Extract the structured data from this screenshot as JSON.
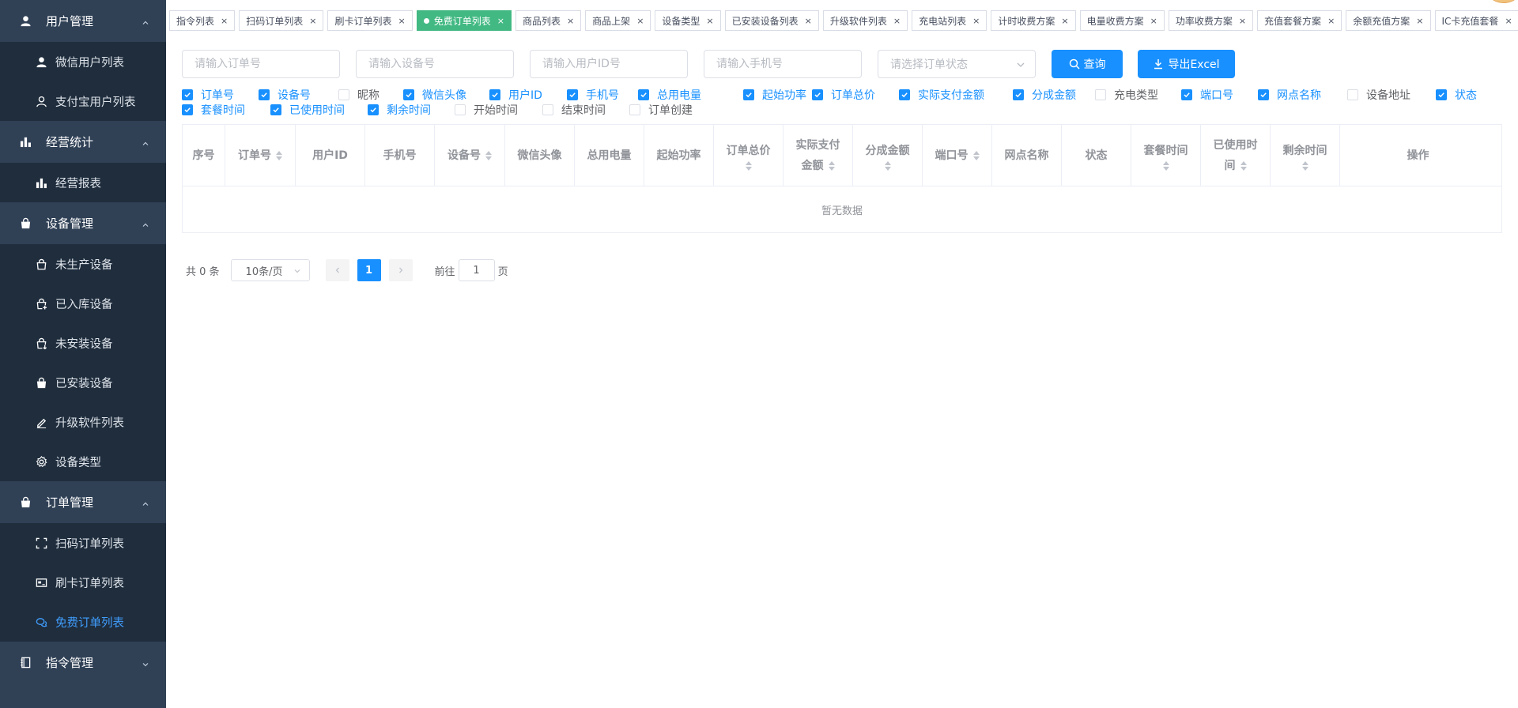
{
  "sidebar": {
    "groups": [
      {
        "title": "用户管理",
        "icon": "user-icon",
        "items": [
          {
            "label": "微信用户列表",
            "icon": "user-icon"
          },
          {
            "label": "支付宝用户列表",
            "icon": "user-outline-icon"
          }
        ]
      },
      {
        "title": "经营统计",
        "icon": "bar-chart-icon",
        "items": [
          {
            "label": "经营报表",
            "icon": "bar-chart-icon"
          }
        ]
      },
      {
        "title": "设备管理",
        "icon": "bag-icon",
        "items": [
          {
            "label": "未生产设备",
            "icon": "bag-outline-icon"
          },
          {
            "label": "已入库设备",
            "icon": "bag-plus-icon"
          },
          {
            "label": "未安装设备",
            "icon": "bag-minus-icon"
          },
          {
            "label": "已安装设备",
            "icon": "bag-icon"
          },
          {
            "label": "升级软件列表",
            "icon": "pencil-icon"
          },
          {
            "label": "设备类型",
            "icon": "gear-icon"
          }
        ]
      },
      {
        "title": "订单管理",
        "icon": "bag-icon",
        "items": [
          {
            "label": "扫码订单列表",
            "icon": "scan-icon"
          },
          {
            "label": "刷卡订单列表",
            "icon": "card-icon"
          },
          {
            "label": "免费订单列表",
            "icon": "free-order-icon",
            "active": true
          }
        ]
      },
      {
        "title": "指令管理",
        "icon": "notebook-icon",
        "items": []
      }
    ]
  },
  "tags": [
    {
      "label": "指令列表"
    },
    {
      "label": "扫码订单列表"
    },
    {
      "label": "刷卡订单列表"
    },
    {
      "label": "免费订单列表",
      "active": true
    },
    {
      "label": "商品列表"
    },
    {
      "label": "商品上架"
    },
    {
      "label": "设备类型"
    },
    {
      "label": "已安装设备列表"
    },
    {
      "label": "升级软件列表"
    },
    {
      "label": "充电站列表"
    },
    {
      "label": "计时收费方案"
    },
    {
      "label": "电量收费方案"
    },
    {
      "label": "功率收费方案"
    },
    {
      "label": "充值套餐方案"
    },
    {
      "label": "余额充值方案"
    },
    {
      "label": "IC卡充值套餐"
    }
  ],
  "filters": {
    "order_no_placeholder": "请输入订单号",
    "device_no_placeholder": "请输入设备号",
    "user_id_placeholder": "请输入用户ID号",
    "phone_placeholder": "请输入手机号",
    "status_placeholder": "请选择订单状态",
    "query_label": "查询",
    "export_label": "导出Excel"
  },
  "columns_toggle": [
    {
      "label": "订单号",
      "checked": true
    },
    {
      "label": "设备号",
      "checked": true
    },
    {
      "label": "昵称",
      "checked": false
    },
    {
      "label": "微信头像",
      "checked": true
    },
    {
      "label": "用户ID",
      "checked": true
    },
    {
      "label": "手机号",
      "checked": true
    },
    {
      "label": "总用电量",
      "checked": true
    },
    {
      "label": "起始功率",
      "checked": true
    },
    {
      "label": "订单总价",
      "checked": true
    },
    {
      "label": "实际支付金额",
      "checked": true
    },
    {
      "label": "分成金额",
      "checked": true
    },
    {
      "label": "充电类型",
      "checked": false
    },
    {
      "label": "端口号",
      "checked": true
    },
    {
      "label": "网点名称",
      "checked": true
    },
    {
      "label": "设备地址",
      "checked": false
    },
    {
      "label": "状态",
      "checked": true
    },
    {
      "label": "套餐时间",
      "checked": true
    },
    {
      "label": "已使用时间",
      "checked": true
    },
    {
      "label": "剩余时间",
      "checked": true
    },
    {
      "label": "开始时间",
      "checked": false
    },
    {
      "label": "结束时间",
      "checked": false
    },
    {
      "label": "订单创建",
      "checked": false
    }
  ],
  "table": {
    "headers": [
      {
        "lines": [
          "序号"
        ],
        "sortable": false
      },
      {
        "lines": [
          "订单号"
        ],
        "sortable": true
      },
      {
        "lines": [
          "用户ID"
        ],
        "sortable": false
      },
      {
        "lines": [
          "手机号"
        ],
        "sortable": false
      },
      {
        "lines": [
          "设备号"
        ],
        "sortable": true
      },
      {
        "lines": [
          "微信头像"
        ],
        "sortable": false
      },
      {
        "lines": [
          "总用电量"
        ],
        "sortable": false
      },
      {
        "lines": [
          "起始功率"
        ],
        "sortable": false
      },
      {
        "lines": [
          "订单总价"
        ],
        "sortable": true,
        "sort_below": true
      },
      {
        "lines": [
          "实际支付",
          "金额"
        ],
        "sortable": true
      },
      {
        "lines": [
          "分成金额"
        ],
        "sortable": true,
        "sort_below": true
      },
      {
        "lines": [
          "端口号"
        ],
        "sortable": true
      },
      {
        "lines": [
          "网点名称"
        ],
        "sortable": false
      },
      {
        "lines": [
          "状态"
        ],
        "sortable": false
      },
      {
        "lines": [
          "套餐时间"
        ],
        "sortable": true,
        "sort_below": true
      },
      {
        "lines": [
          "已使用时",
          "间"
        ],
        "sortable": true
      },
      {
        "lines": [
          "剩余时间"
        ],
        "sortable": true,
        "sort_below": true
      },
      {
        "lines": [
          "操作"
        ],
        "sortable": false
      }
    ],
    "empty_text": "暂无数据"
  },
  "pagination": {
    "total_text": "共 0 条",
    "page_size": "10条/页",
    "current_page": "1",
    "goto_prefix": "前往",
    "goto_value": "1",
    "goto_suffix": "页"
  },
  "colors": {
    "sidebar_bg": "#304156",
    "submenu_bg": "#1f2d3d",
    "primary": "#1890ff",
    "active_tag": "#42b983"
  }
}
